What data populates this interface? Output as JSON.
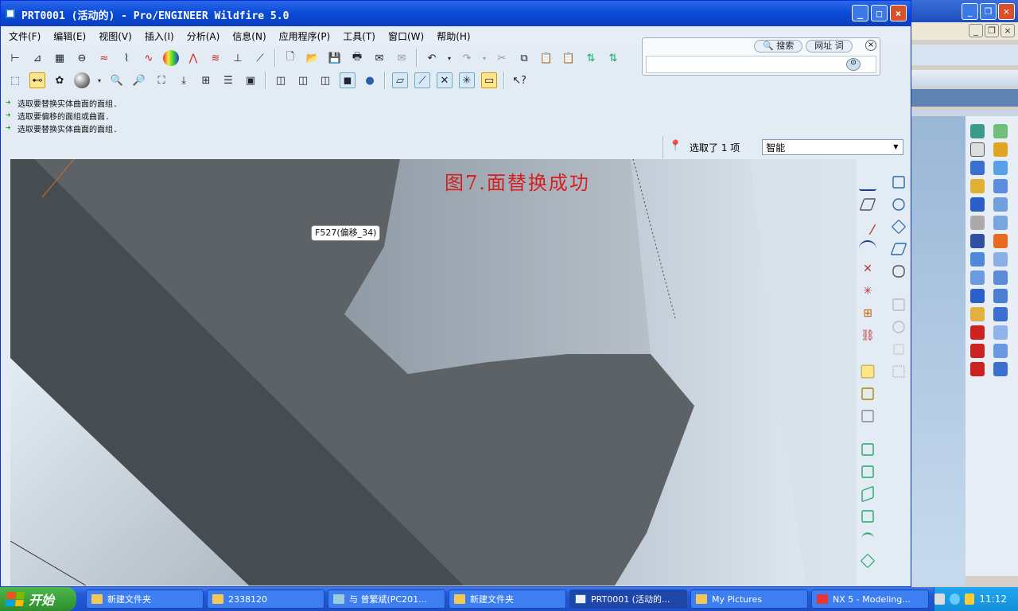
{
  "window": {
    "title": "PRT0001 (活动的) - Pro/ENGINEER Wildfire 5.0",
    "controls": [
      "_",
      "□",
      "×"
    ]
  },
  "menu": [
    "文件(F)",
    "编辑(E)",
    "视图(V)",
    "插入(I)",
    "分析(A)",
    "信息(N)",
    "应用程序(P)",
    "工具(T)",
    "窗口(W)",
    "帮助(H)"
  ],
  "search_bar": {
    "search_label": "搜索",
    "url_label": "网址",
    "word_label": "词",
    "close": "×"
  },
  "messages": [
    "选取要替换实体曲面的面组.",
    "选取要偏移的面组或曲面.",
    "选取要替换实体曲面的面组."
  ],
  "status": {
    "selected": "选取了 1 项",
    "filter_value": "智能"
  },
  "viewport": {
    "caption": "图7.面替换成功",
    "tooltip": "F527(偏移_34)"
  },
  "taskbar": {
    "start": "开始",
    "items": [
      {
        "label": "新建文件夹",
        "icon": "folder-icon"
      },
      {
        "label": "2338120",
        "icon": "folder-icon"
      },
      {
        "label": "与 曾繁斌(PC201...",
        "icon": "chat-icon"
      },
      {
        "label": "新建文件夹",
        "icon": "folder-icon"
      },
      {
        "label": "PRT0001 (活动的...",
        "icon": "proe-app-icon"
      },
      {
        "label": "My Pictures",
        "icon": "folder-icon"
      },
      {
        "label": "NX 5 - Modeling...",
        "icon": "nx-app-icon"
      }
    ],
    "clock": "11:12"
  },
  "colors": {
    "titlebar": "#0a4ad6",
    "caption": "#d61f1f",
    "model_dark": "#474c51",
    "model_mid": "#5f6469",
    "model_light": "#a9b3bd"
  }
}
